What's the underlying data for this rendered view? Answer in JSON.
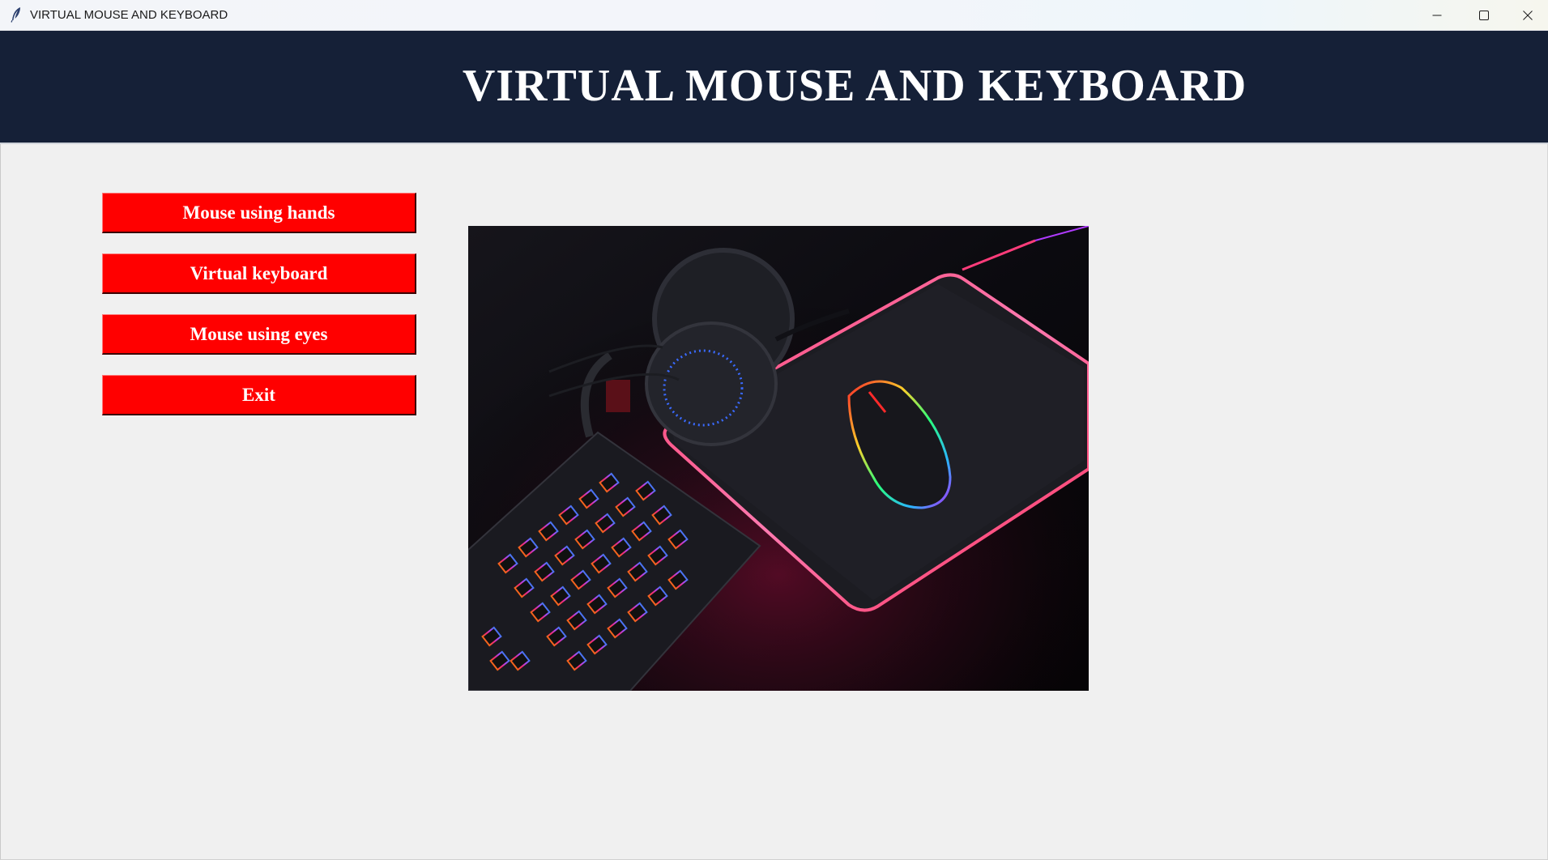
{
  "window": {
    "title": "VIRTUAL MOUSE AND KEYBOARD",
    "controls": {
      "minimize_icon": "minimize-icon",
      "maximize_icon": "maximize-icon",
      "close_icon": "close-icon"
    },
    "app_icon": "feather-icon"
  },
  "header": {
    "title": "VIRTUAL MOUSE AND KEYBOARD",
    "background_color": "#152037",
    "text_color": "#ffffff"
  },
  "menu": {
    "button_color": "#ff0000",
    "buttons": [
      {
        "label": "Mouse using hands"
      },
      {
        "label": "Virtual keyboard"
      },
      {
        "label": "Mouse using eyes"
      },
      {
        "label": "Exit"
      }
    ]
  },
  "image": {
    "description": "gaming-setup-photo"
  }
}
